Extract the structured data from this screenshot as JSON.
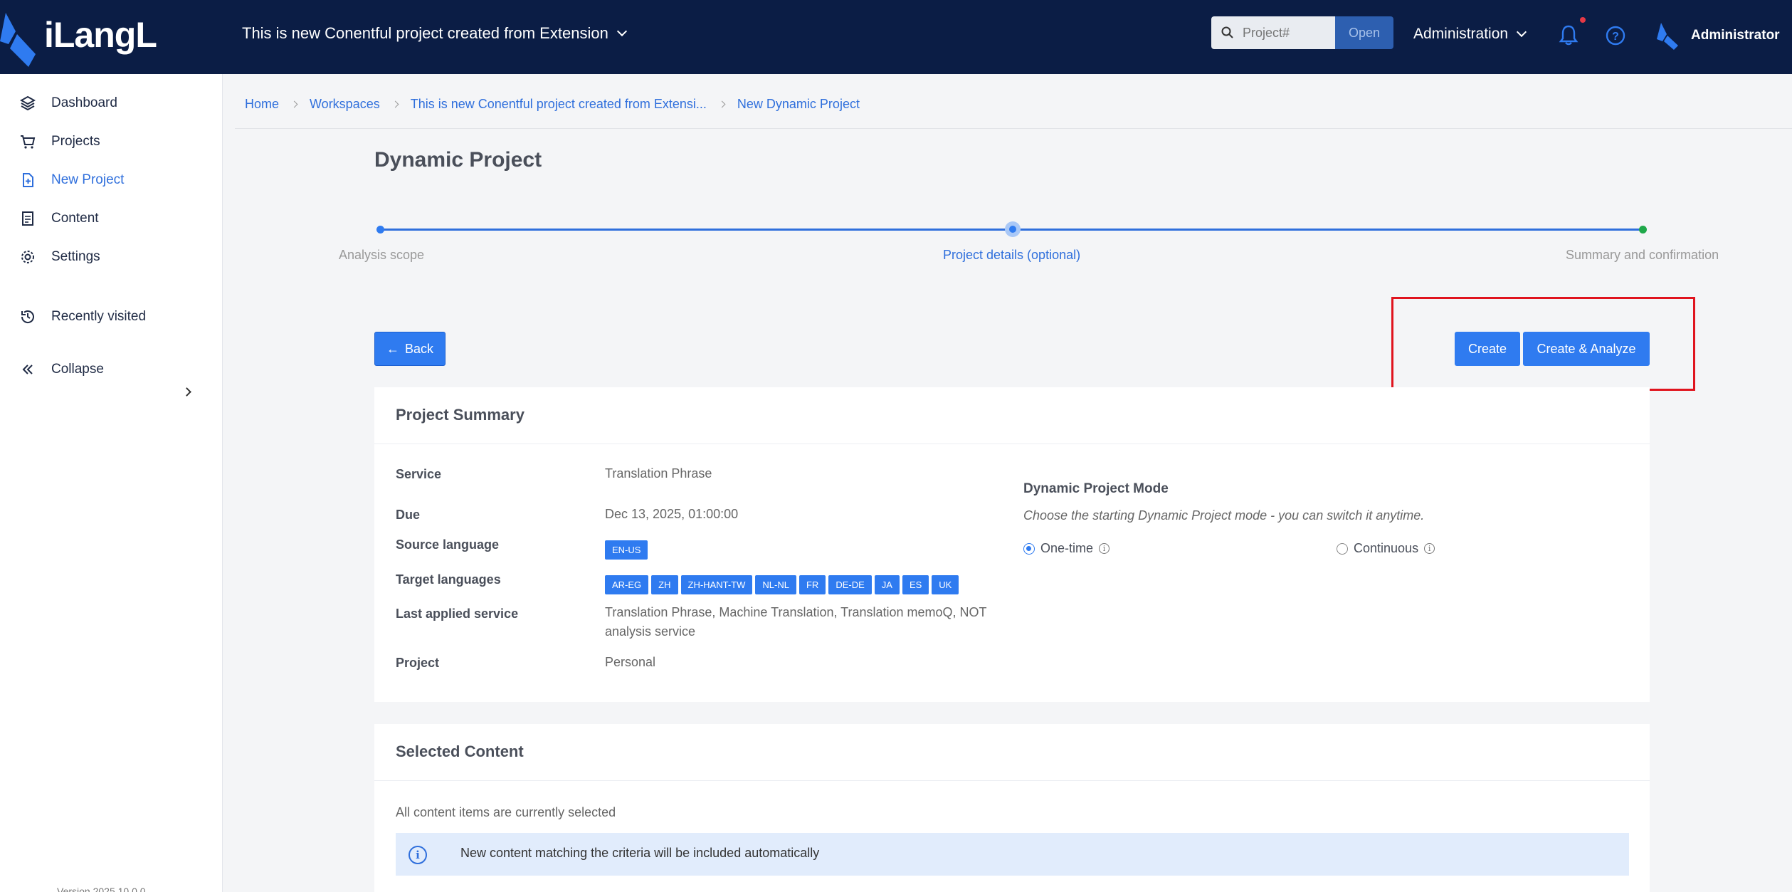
{
  "header": {
    "logo_text": "iLangL",
    "project_title": "This is new Conentful project created from Extension",
    "search_placeholder": "Project#",
    "open_label": "Open",
    "admin_menu_label": "Administration",
    "user_name": "Administrator"
  },
  "sidebar": {
    "items": [
      {
        "label": "Dashboard",
        "icon": "layers-icon"
      },
      {
        "label": "Projects",
        "icon": "cart-icon"
      },
      {
        "label": "New Project",
        "icon": "new-file-icon",
        "active": true
      },
      {
        "label": "Content",
        "icon": "document-icon"
      },
      {
        "label": "Settings",
        "icon": "gear-icon"
      },
      {
        "label": "Recently visited",
        "icon": "history-icon"
      },
      {
        "label": "Collapse",
        "icon": "double-chevron-left-icon"
      }
    ],
    "version": "Version 2025.10.0.0"
  },
  "breadcrumb": [
    "Home",
    "Workspaces",
    "This is new Conentful project created from Extensi...",
    "New Dynamic Project"
  ],
  "page_title": "Dynamic Project",
  "stepper": {
    "steps": [
      "Analysis scope",
      "Project details (optional)",
      "Summary and confirmation"
    ],
    "current_index": 1
  },
  "actions": {
    "back_label": "Back",
    "create_label": "Create",
    "create_analyze_label": "Create & Analyze"
  },
  "summary": {
    "title": "Project Summary",
    "service_label": "Service",
    "service_value": "Translation Phrase",
    "due_label": "Due",
    "due_value": "Dec 13, 2025, 01:00:00",
    "source_label": "Source language",
    "source_languages": [
      "EN-US"
    ],
    "target_label": "Target languages",
    "target_languages": [
      "AR-EG",
      "ZH",
      "ZH-HANT-TW",
      "NL-NL",
      "FR",
      "DE-DE",
      "JA",
      "ES",
      "UK"
    ],
    "last_service_label": "Last applied service",
    "last_service_value": "Translation Phrase, Machine Translation, Translation memoQ, NOT analysis service",
    "project_label": "Project",
    "project_value": "Personal",
    "mode_title": "Dynamic Project Mode",
    "mode_desc": "Choose the starting Dynamic Project mode - you can switch it anytime.",
    "mode_options": [
      "One-time",
      "Continuous"
    ],
    "mode_selected": "One-time"
  },
  "selected_content": {
    "title": "Selected Content",
    "status": "All content items are currently selected",
    "info": "New content matching the criteria will be included automatically"
  },
  "colors": {
    "header_bg": "#0b1d45",
    "accent": "#2f7bf0",
    "highlight": "#e0141e",
    "step_done": "#1fa84a"
  }
}
